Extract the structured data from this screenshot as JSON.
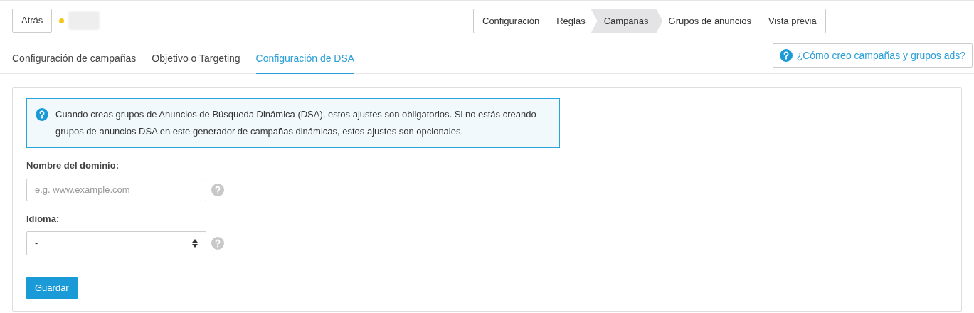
{
  "header": {
    "back_button": "Atrás",
    "status": {
      "color": "#f5c518"
    }
  },
  "steps": [
    {
      "label": "Configuración",
      "selected": false
    },
    {
      "label": "Reglas",
      "selected": false
    },
    {
      "label": "Campañas",
      "selected": true
    },
    {
      "label": "Grupos de anuncios",
      "selected": false
    },
    {
      "label": "Vista previa",
      "selected": false
    }
  ],
  "tabs": [
    {
      "label": "Configuración de campañas",
      "selected": false
    },
    {
      "label": "Objetivo o Targeting",
      "selected": false
    },
    {
      "label": "Configuración de DSA",
      "selected": true
    }
  ],
  "help_link": "¿Cómo creo campañas y grupos ads?",
  "form": {
    "info": "Cuando creas grupos de Anuncios de Búsqueda Dinámica (DSA), estos ajustes son obligatorios. Si no estás creando grupos de anuncios DSA en este generador de campañas dinámicas, estos ajustes son opcionales.",
    "fields": [
      {
        "kind": "text",
        "label": "Nombre del dominio:",
        "placeholder": "e.g. www.example.com"
      },
      {
        "kind": "select",
        "label": "Idioma:",
        "value": "-"
      }
    ],
    "save_button": "Guardar"
  }
}
